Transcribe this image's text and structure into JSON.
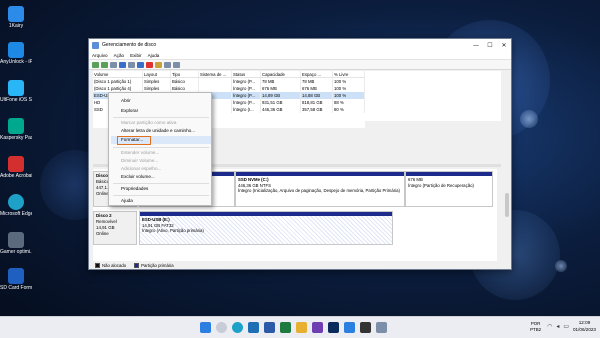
{
  "desktop": {
    "icons": [
      {
        "label": "1Kairy",
        "icon": "app-icon",
        "color": "#2c8be8"
      },
      {
        "label": "AnyUnlock - iPhone Pas...",
        "icon": "lock-app-icon",
        "color": "#1e88e5"
      },
      {
        "label": "UltFone iOS System Re...",
        "icon": "repair-app-icon",
        "color": "#29b6f6"
      },
      {
        "label": "Kaspersky Passwor...",
        "icon": "kaspersky-icon",
        "color": "#00a88e"
      },
      {
        "label": "Adobe Acrobat",
        "icon": "acrobat-icon",
        "color": "#d32f2f"
      },
      {
        "label": "Microsoft Edge",
        "icon": "edge-icon",
        "color": "#1da1c8"
      },
      {
        "label": "Gamer optimi...",
        "icon": "game-optimizer-icon",
        "color": "#5b6b7d"
      },
      {
        "label": "SD Card Formatter",
        "icon": "sd-card-icon",
        "color": "#1f5fbf"
      }
    ]
  },
  "window": {
    "title": "Gerenciamento de disco",
    "controls": {
      "minimize": "—",
      "maximize": "☐",
      "close": "✕"
    },
    "menu": [
      "Arquivo",
      "Ação",
      "Exibir",
      "Ajuda"
    ]
  },
  "volumes": {
    "headers": [
      "Volume",
      "Layout",
      "Tipo",
      "Sistema de ...",
      "Status",
      "Capacidade",
      "Espaço ...",
      "% Livre"
    ],
    "rows": [
      [
        "(Disco 1 partição 1)",
        "Simples",
        "Básico",
        "",
        "Íntegro (P...",
        "78 MB",
        "78 MB",
        "100 %"
      ],
      [
        "(Disco 1 partição 4)",
        "Simples",
        "Básico",
        "",
        "Íntegro (P...",
        "676 MB",
        "676 MB",
        "100 %"
      ],
      [
        "ESD-USB (E:)",
        "Simples",
        "Básico",
        "FAT32",
        "Íntegro (P...",
        "14,89 GB",
        "14,88 GB",
        "100 %"
      ],
      [
        "HD",
        "Simples",
        "Básico",
        "",
        "Íntegro (P...",
        "931,51 GB",
        "818,81 GB",
        "88 %"
      ],
      [
        "SSD",
        "Simples",
        "Básico",
        "",
        "Íntegro (I...",
        "446,36 GB",
        "357,58 GB",
        "80 %"
      ]
    ]
  },
  "disks": [
    {
      "name": "Disco 1",
      "type": "Básico",
      "size": "447,1...",
      "status": "Online",
      "partitions": [
        {
          "name": "SSD NVMe (C:)",
          "detail": "446,36 GB NTFS",
          "status": "Íntegro (Inicialização, Arquivo de paginação, Despejo de memória, Partição Primária)"
        },
        {
          "name": "",
          "detail": "676 MB",
          "status": "Íntegro (Partição de Recuperação)"
        }
      ]
    },
    {
      "name": "Disco 2",
      "type": "Removível",
      "size": "14,91 GB",
      "status": "Online",
      "partitions": [
        {
          "name": "ESD-USB (E:)",
          "detail": "14,91 GB FAT32",
          "status": "Íntegro (Ativo, Partição primária)"
        }
      ]
    }
  ],
  "legend": [
    {
      "label": "Não alocado",
      "color": "#111111"
    },
    {
      "label": "Partição primária",
      "color": "#1d2b8c"
    }
  ],
  "context_menu": {
    "items": [
      {
        "label": "Abrir",
        "enabled": true
      },
      {
        "label": "Explorar",
        "enabled": true
      },
      {
        "label": "Marcar partição como ativa",
        "enabled": false
      },
      {
        "label": "Alterar letra de unidade e caminho...",
        "enabled": true
      },
      {
        "label": "Formatar...",
        "enabled": true,
        "highlighted": true
      },
      {
        "label": "Estender volume...",
        "enabled": false
      },
      {
        "label": "Diminuir Volume...",
        "enabled": false
      },
      {
        "label": "Adicionar espelho...",
        "enabled": false
      },
      {
        "label": "Excluir volume...",
        "enabled": true
      },
      {
        "label": "Propriedades",
        "enabled": true
      },
      {
        "label": "Ajuda",
        "enabled": true
      }
    ]
  },
  "taskbar": {
    "language": "POR",
    "layout": "PTB2",
    "time": "12:09",
    "date": "01/06/2023"
  }
}
